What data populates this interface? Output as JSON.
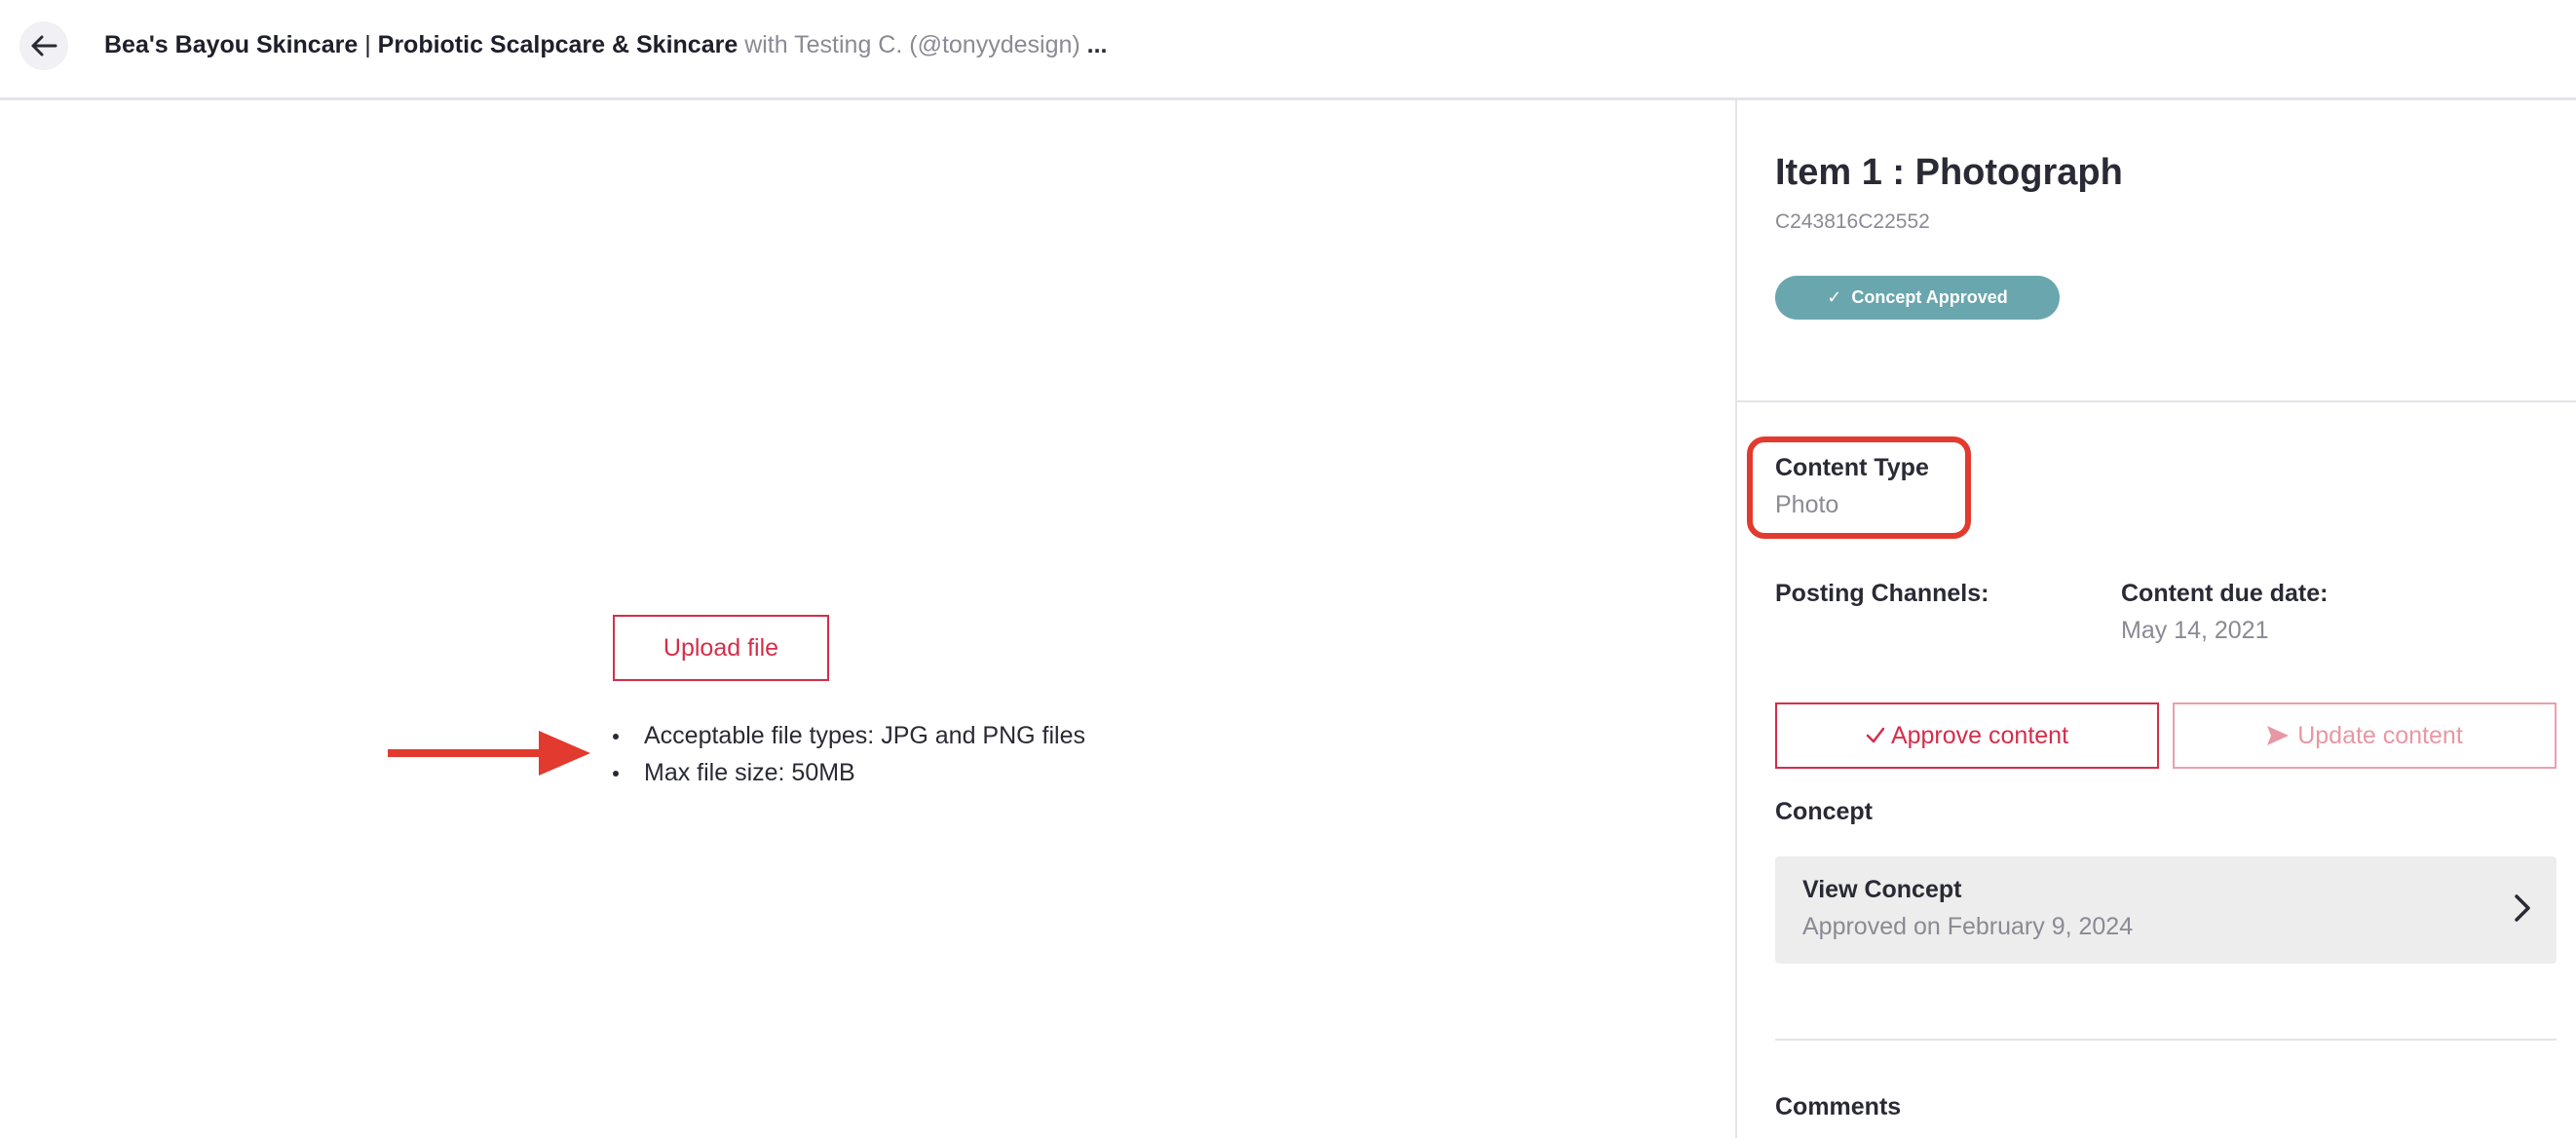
{
  "header": {
    "brand": "Bea's Bayou Skincare",
    "separator": " | ",
    "subtitle": "Probiotic Scalpcare & Skincare",
    "creator": " with Testing C. (@tonyydesign)",
    "ellipsis": " ...",
    "back_icon": "arrow-left-icon"
  },
  "upload": {
    "button_label": "Upload file",
    "requirements": [
      "Acceptable file types: JPG and PNG files",
      "Max file size: 50MB"
    ]
  },
  "item": {
    "title": "Item 1 : Photograph",
    "id": "C243816C22552",
    "status": "Concept Approved",
    "status_color": "#6aa6ae"
  },
  "details": {
    "content_type_label": "Content Type",
    "content_type_value": "Photo",
    "posting_channels_label": "Posting Channels:",
    "due_date_label": "Content due date:",
    "due_date_value": "May 14, 2021"
  },
  "actions": {
    "approve_label": "Approve content",
    "update_label": "Update content",
    "accent_color": "#d42e4a"
  },
  "concept": {
    "section_label": "Concept",
    "card_title": "View Concept",
    "card_subtitle": "Approved on February 9, 2024"
  },
  "comments": {
    "section_label": "Comments"
  },
  "annotations": {
    "highlight_color": "#e23a2e"
  }
}
